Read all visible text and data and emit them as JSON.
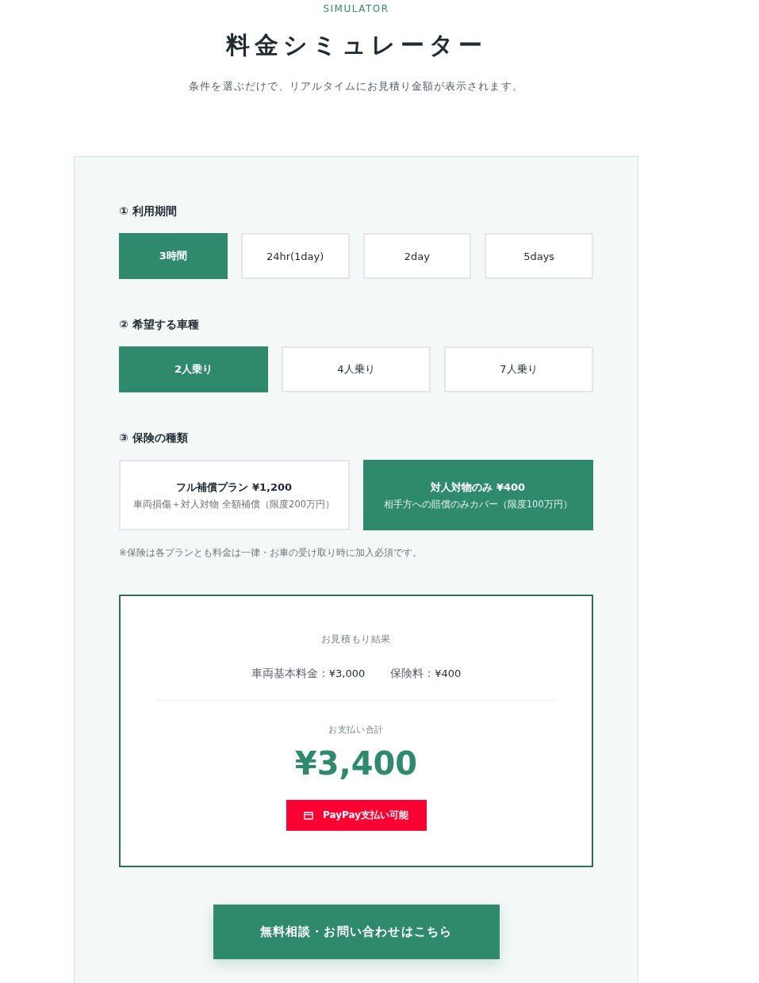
{
  "header": {
    "eyebrow": "SIMULATOR",
    "title": "料金シミュレーター",
    "lead": "条件を選ぶだけで、リアルタイムにお見積り金額が表示されます。"
  },
  "sections": [
    {
      "label": "① 利用期間",
      "kind": "choices",
      "options": [
        {
          "label": "3時間",
          "selected": true
        },
        {
          "label": "24hr(1day)",
          "selected": false
        },
        {
          "label": "2day",
          "selected": false
        },
        {
          "label": "5days",
          "selected": false
        }
      ]
    },
    {
      "label": "② 希望する車種",
      "kind": "choices",
      "options": [
        {
          "label": "2人乗り",
          "selected": true
        },
        {
          "label": "4人乗り",
          "selected": false
        },
        {
          "label": "7人乗り",
          "selected": false
        }
      ]
    },
    {
      "label": "③ 保険の種類",
      "kind": "plans",
      "options": [
        {
          "name": "フル補償プラン ¥1,200",
          "description": "車両損傷＋対人対物 全額補償（限度200万円）",
          "selected": false
        },
        {
          "name": "対人対物のみ ¥400",
          "description": "相手方への賠償のみカバー（限度100万円）",
          "selected": true
        }
      ],
      "note": "※保険は各プランとも料金は一律・お車の受け取り時に加入必須です。"
    }
  ],
  "result": {
    "heading": "お見積もり結果",
    "breakdown": [
      {
        "label": "車両基本料金：",
        "value": "¥3,000"
      },
      {
        "label": "保険料：",
        "value": "¥400"
      }
    ],
    "total_label": "お支払い合計",
    "total": "¥3,400",
    "payment_badge": "PayPay支払い可能"
  },
  "cta": "無料相談・お問い合わせはこちら"
}
